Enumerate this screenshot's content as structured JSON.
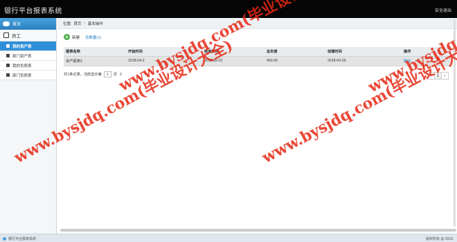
{
  "app": {
    "title": "银行平台报表系统",
    "logout": "安全退出"
  },
  "sidebar": {
    "home": "首页",
    "group": "员工",
    "items": [
      {
        "label": "我的资产表",
        "active": true
      },
      {
        "label": "部门资产表",
        "active": false
      },
      {
        "label": "我的负债表",
        "active": false
      },
      {
        "label": "部门负债表",
        "active": false
      }
    ]
  },
  "breadcrumb": {
    "prefix": "位置:",
    "home": "首页",
    "sep": ">",
    "current": "基本操作"
  },
  "toolbar": {
    "add_label": "新建",
    "total_label": "总数量(1)"
  },
  "table": {
    "headers": [
      "报表名称",
      "开始时间",
      "结束时间",
      "总负债",
      "创建时间",
      "操作"
    ],
    "rows": [
      [
        "资产报表3",
        "2018-04-2",
        "2018-05-01",
        "450.00",
        "2018-04-26",
        "删除"
      ]
    ]
  },
  "pagination": {
    "summary": "共1条记录，当前显示第",
    "page_input": "1",
    "page_suffix": "页",
    "tail": "2",
    "prev": "‹",
    "current": "1",
    "next": "›"
  },
  "footer": {
    "left": "银行平台报表系统",
    "right": "版权所有 @ 2018"
  },
  "watermarks": [
    "www.bysjdq.com(毕业设计大全)",
    "www.bysjdq.com(毕业设计大全)",
    "www.bysjdq.com(毕业设计大全)",
    "www.bysjdq.com(毕业设计大全)"
  ],
  "colors": {
    "accent": "#2f8fd8",
    "topbar": "#050505",
    "watermark": "#e62814"
  }
}
